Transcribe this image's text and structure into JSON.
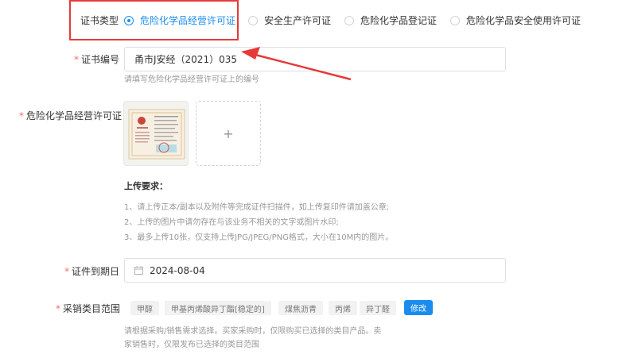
{
  "cert_type": {
    "label": "证书类型",
    "options": [
      "危险化学品经营许可证",
      "安全生产许可证",
      "危险化学品登记证",
      "危险化学品安全使用许可证"
    ],
    "selected_index": 0
  },
  "cert_number": {
    "required_mark": "*",
    "label": "证书编号",
    "value": "甬市J安经（2021）035",
    "hint": "请填写危险化学品经营许可证上的编号"
  },
  "license_upload": {
    "required_mark": "*",
    "label": "危险化学品经营许可证",
    "add_symbol": "+",
    "requirements_title": "上传要求：",
    "requirements": [
      "1、请上传正本/副本以及附件等完成证件扫描件，如上传复印件请加盖公章;",
      "2、上传的图片中请勿存在与该业务不相关的文字或图片水印;",
      "3、最多上传10张，仅支持上传JPG/JPEG/PNG格式，大小在10M内的图片。"
    ]
  },
  "expiry": {
    "required_mark": "*",
    "label": "证件到期日",
    "value": "2024-08-04"
  },
  "category": {
    "required_mark": "*",
    "label": "采销类目范围",
    "tags": [
      "甲醇",
      "甲基丙烯酸异丁酯[稳定的]",
      "煤焦沥青",
      "丙烯",
      "异丁醛"
    ],
    "modify_label": "修改",
    "hint_line1": "请根据采购/销售需求选择。买家采购时，仅限购买已选择的类目产品。卖",
    "hint_line2": "家销售时，仅限发布已选择的类目范围"
  },
  "colors": {
    "accent": "#1a8cf0",
    "required": "#f56c6c",
    "annotation": "#e63a3a"
  }
}
